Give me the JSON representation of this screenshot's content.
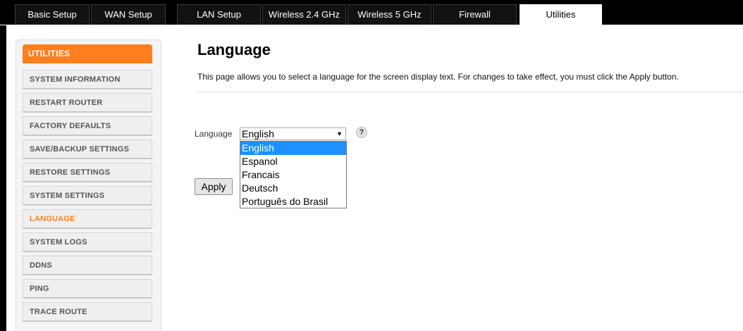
{
  "topnav": {
    "tabs": [
      {
        "label": "Basic Setup"
      },
      {
        "label": "WAN Setup"
      },
      {
        "label": "LAN Setup"
      },
      {
        "label": "Wireless 2.4 GHz"
      },
      {
        "label": "Wireless 5 GHz"
      },
      {
        "label": "Firewall"
      },
      {
        "label": "Utilities"
      }
    ],
    "active_tab": "Utilities"
  },
  "sidebar": {
    "header": "UTILITIES",
    "items": [
      {
        "label": "SYSTEM INFORMATION"
      },
      {
        "label": "RESTART ROUTER"
      },
      {
        "label": "FACTORY DEFAULTS"
      },
      {
        "label": "SAVE/BACKUP SETTINGS"
      },
      {
        "label": "RESTORE SETTINGS"
      },
      {
        "label": "SYSTEM SETTINGS"
      },
      {
        "label": "LANGUAGE"
      },
      {
        "label": "SYSTEM LOGS"
      },
      {
        "label": "DDNS"
      },
      {
        "label": "PING"
      },
      {
        "label": "TRACE ROUTE"
      }
    ],
    "active_item": "LANGUAGE"
  },
  "main": {
    "title": "Language",
    "description": "This page allows you to select a language for the screen display text. For changes to take effect, you must click the Apply button.",
    "language_label": "Language",
    "language_value": "English",
    "help_icon": "?",
    "dropdown_options": [
      "English",
      "Espanol",
      "Francais",
      "Deutsch",
      "Português do Brasil"
    ],
    "apply_label": "Apply"
  },
  "colors": {
    "accent": "#ff7f1e",
    "selection": "#1e90ff",
    "nav_bg": "#000000"
  },
  "icons": {
    "select_arrow": "chevron-down-icon",
    "help": "help-icon"
  }
}
